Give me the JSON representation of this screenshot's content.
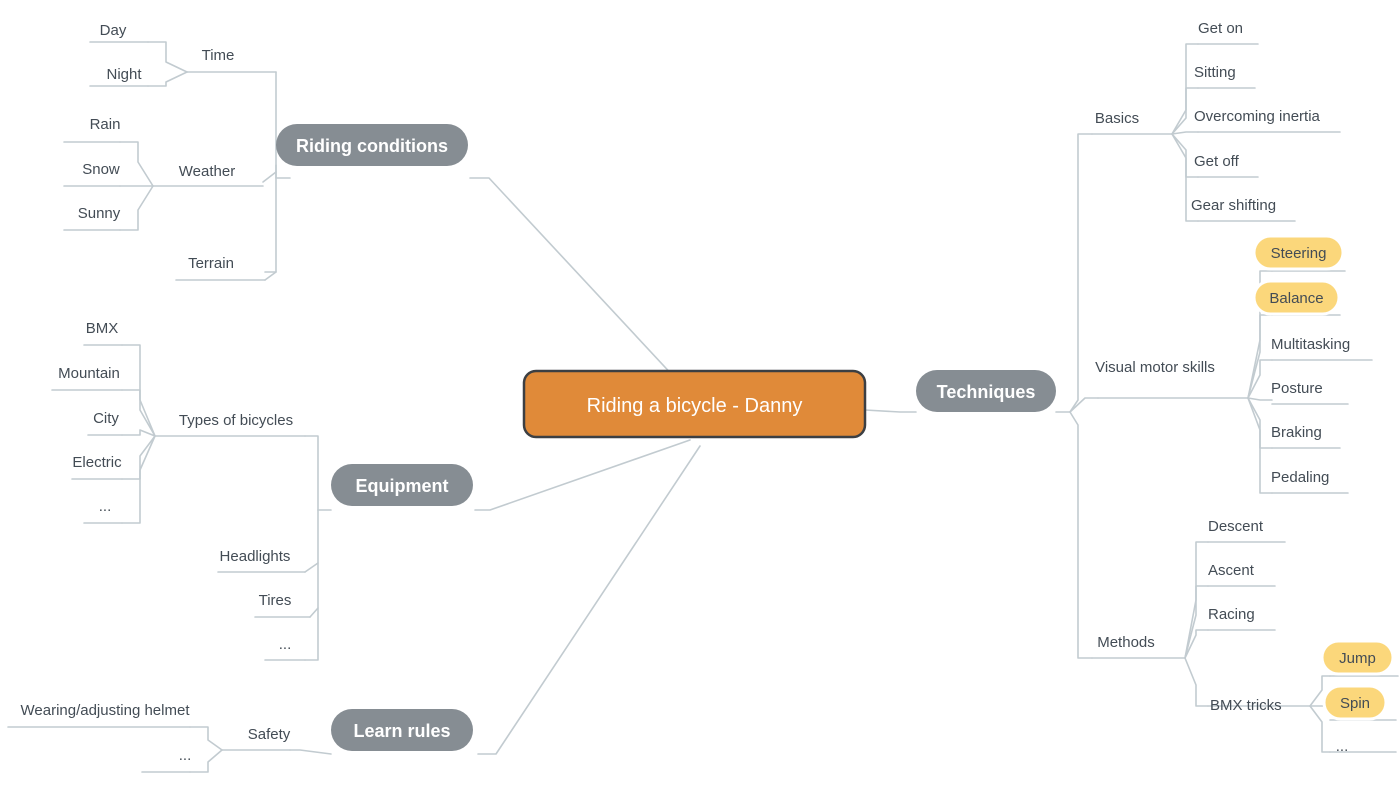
{
  "colors": {
    "root_fill": "#e08a39",
    "root_stroke": "#3c3f43",
    "main_fill": "#868d93",
    "highlight_fill": "#fbd77b",
    "highlight_stroke": "#ffffff",
    "edge": "#c2cbd0",
    "text": "#434c55",
    "background": "#ffffff"
  },
  "root": {
    "label": "Riding a bicycle - Danny"
  },
  "branches": {
    "riding_conditions": {
      "label": "Riding conditions",
      "children": [
        {
          "label": "Time",
          "children": [
            "Day",
            "Night"
          ]
        },
        {
          "label": "Weather",
          "children": [
            "Rain",
            "Snow",
            "Sunny"
          ]
        },
        {
          "label": "Terrain",
          "children": []
        }
      ]
    },
    "equipment": {
      "label": "Equipment",
      "children": [
        {
          "label": "Types of bicycles",
          "children": [
            "BMX",
            "Mountain",
            "City",
            "Electric",
            "..."
          ]
        },
        {
          "label": "Headlights",
          "children": []
        },
        {
          "label": "Tires",
          "children": []
        },
        {
          "label": "...",
          "children": []
        }
      ]
    },
    "learn_rules": {
      "label": "Learn rules",
      "children": [
        {
          "label": "Safety",
          "children": [
            "Wearing/adjusting helmet",
            "..."
          ]
        }
      ]
    },
    "techniques": {
      "label": "Techniques",
      "children": [
        {
          "label": "Basics",
          "children": [
            "Get on",
            "Sitting",
            "Overcoming inertia",
            "Get off",
            "Gear shifting"
          ]
        },
        {
          "label": "Visual motor skills",
          "children": [
            "Steering",
            "Balance",
            "Multitasking",
            "Posture",
            "Braking",
            "Pedaling"
          ]
        },
        {
          "label": "Methods",
          "children": [
            "Descent",
            "Ascent",
            "Racing"
          ]
        },
        {
          "label": "BMX tricks",
          "children": [
            "Jump",
            "Spin",
            "..."
          ]
        }
      ]
    }
  },
  "highlighted": [
    "Steering",
    "Balance",
    "Jump",
    "Spin"
  ],
  "labels": {
    "day": "Day",
    "night": "Night",
    "time": "Time",
    "rain": "Rain",
    "snow": "Snow",
    "sunny": "Sunny",
    "weather": "Weather",
    "terrain": "Terrain",
    "riding_conditions": "Riding conditions",
    "bmx": "BMX",
    "mountain": "Mountain",
    "city": "City",
    "electric": "Electric",
    "types_ellipsis": "...",
    "types_of_bicycles": "Types of bicycles",
    "headlights": "Headlights",
    "tires": "Tires",
    "equip_ellipsis": "...",
    "equipment": "Equipment",
    "wearing_helmet": "Wearing/adjusting helmet",
    "safety_ellipsis": "...",
    "safety": "Safety",
    "learn_rules": "Learn rules",
    "root": "Riding a bicycle - Danny",
    "techniques": "Techniques",
    "get_on": "Get on",
    "sitting": "Sitting",
    "overcoming_inertia": "Overcoming inertia",
    "get_off": "Get off",
    "gear_shifting": "Gear shifting",
    "basics": "Basics",
    "steering": "Steering",
    "balance": "Balance",
    "multitasking": "Multitasking",
    "posture": "Posture",
    "braking": "Braking",
    "pedaling": "Pedaling",
    "visual_motor_skills": "Visual motor skills",
    "descent": "Descent",
    "ascent": "Ascent",
    "racing": "Racing",
    "methods": "Methods",
    "jump": "Jump",
    "spin": "Spin",
    "bmx_ellipsis": "...",
    "bmx_tricks": "BMX tricks"
  }
}
